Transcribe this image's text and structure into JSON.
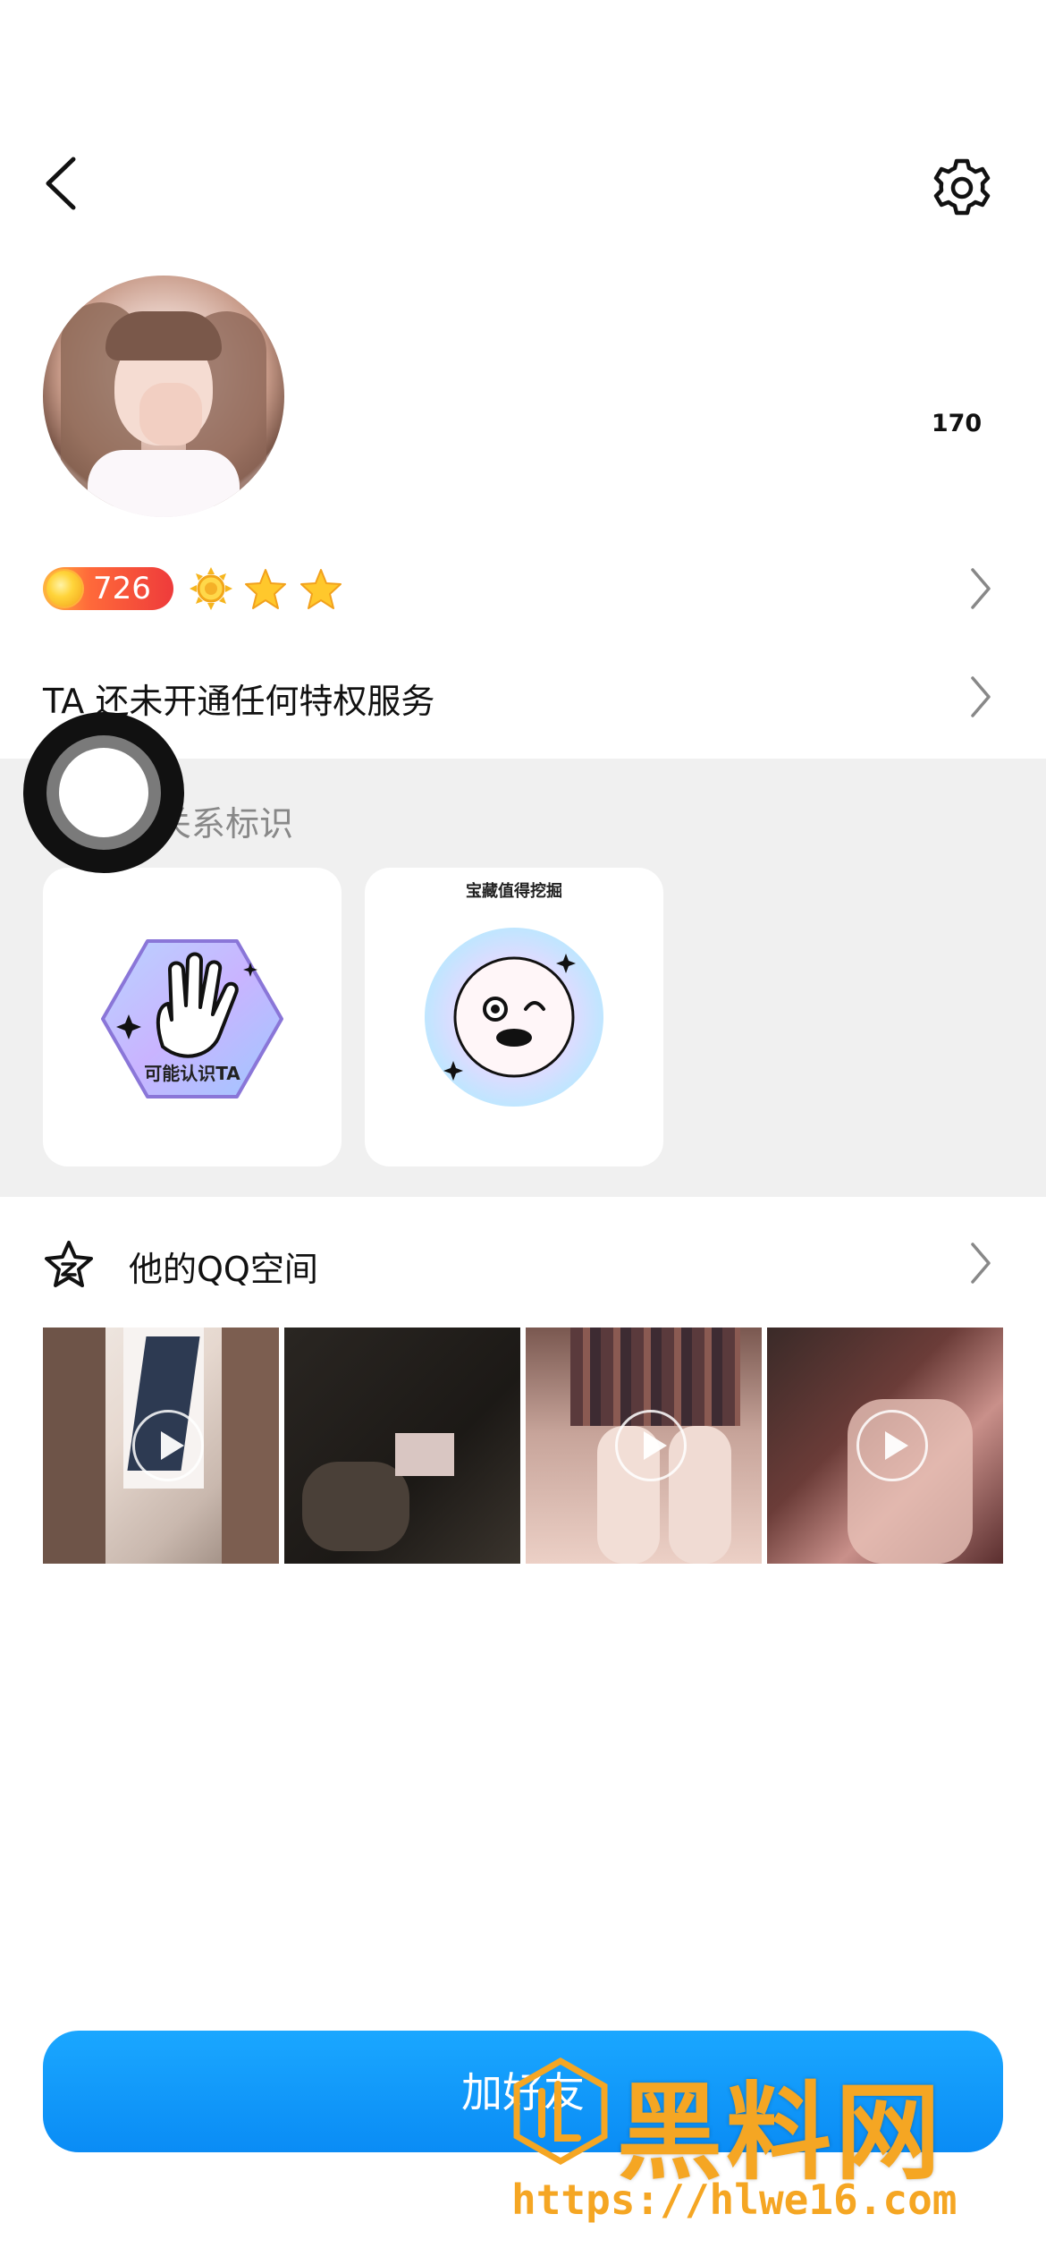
{
  "header": {
    "back_icon": "chevron-left-icon",
    "settings_icon": "gear-icon"
  },
  "profile": {
    "count": "170"
  },
  "level": {
    "value": "726",
    "icons": [
      "sun-icon",
      "star-icon",
      "star-icon"
    ]
  },
  "privilege": {
    "text": "TA 还未开通任何特权服务"
  },
  "relationship": {
    "title_visible": "关系标识",
    "badges": [
      {
        "label": "可能认识TA"
      },
      {
        "label": "宝藏值得挖掘"
      }
    ]
  },
  "qzone": {
    "title": "他的QQ空间"
  },
  "actions": {
    "add_friend": "加好友"
  },
  "watermark": {
    "name": "黑料网",
    "url": "https://hlwe16.com"
  },
  "colors": {
    "accent": "#0a8cf5",
    "watermark": "#f5a623",
    "section_bg": "#f0f0f0"
  }
}
